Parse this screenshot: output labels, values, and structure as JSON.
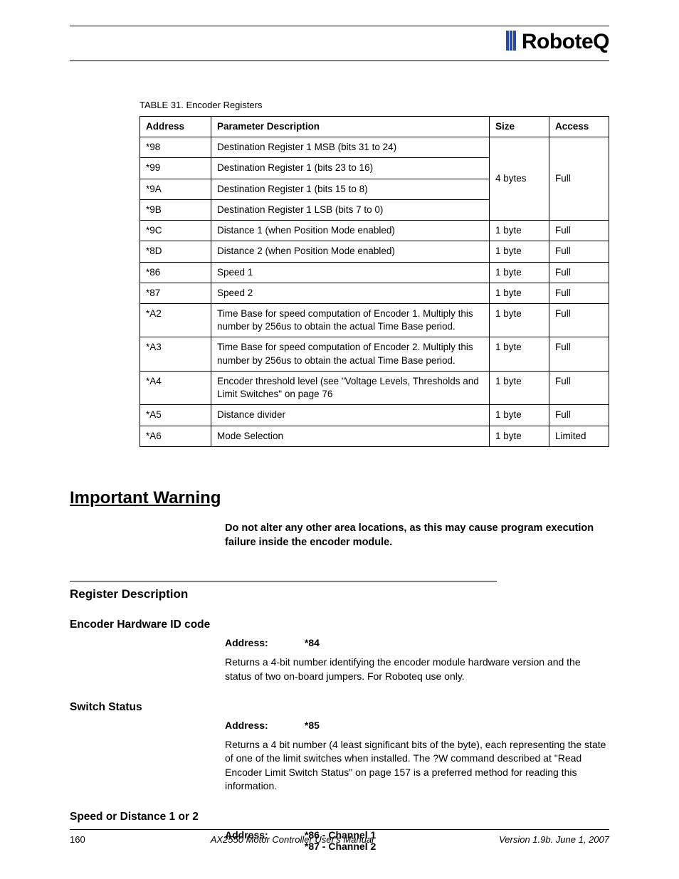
{
  "brand": "RoboteQ",
  "table": {
    "caption_label": "TABLE 31.",
    "caption_title": "Encoder Registers",
    "headers": {
      "address": "Address",
      "desc": "Parameter Description",
      "size": "Size",
      "access": "Access"
    },
    "group1": {
      "size": "4 bytes",
      "access": "Full",
      "rows": [
        {
          "addr": "*98",
          "desc": "Destination Register 1 MSB (bits 31 to 24)"
        },
        {
          "addr": "*99",
          "desc": "Destination Register 1 (bits 23 to 16)"
        },
        {
          "addr": "*9A",
          "desc": "Destination Register 1 (bits 15 to 8)"
        },
        {
          "addr": "*9B",
          "desc": "Destination Register 1 LSB (bits 7 to 0)"
        }
      ]
    },
    "rows": [
      {
        "addr": "*9C",
        "desc": "Distance 1 (when Position Mode enabled)",
        "size": "1 byte",
        "access": "Full"
      },
      {
        "addr": "*8D",
        "desc": "Distance 2 (when Position Mode enabled)",
        "size": "1 byte",
        "access": "Full"
      },
      {
        "addr": "*86",
        "desc": "Speed 1",
        "size": "1 byte",
        "access": "Full"
      },
      {
        "addr": "*87",
        "desc": "Speed 2",
        "size": "1 byte",
        "access": "Full"
      },
      {
        "addr": "*A2",
        "desc": "Time Base for speed computation of Encoder 1. Multiply this number by 256us to obtain the actual Time Base period.",
        "size": "1 byte",
        "access": "Full"
      },
      {
        "addr": "*A3",
        "desc": "Time Base for speed computation of Encoder 2. Multiply this number by 256us to obtain the actual Time Base period.",
        "size": "1 byte",
        "access": "Full"
      },
      {
        "addr": "*A4",
        "desc": "Encoder threshold level (see \"Voltage Levels, Thresholds and Limit Switches\" on page 76",
        "size": "1 byte",
        "access": "Full"
      },
      {
        "addr": "*A5",
        "desc": "Distance divider",
        "size": "1 byte",
        "access": "Full"
      },
      {
        "addr": "*A6",
        "desc": "Mode Selection",
        "size": "1 byte",
        "access": "Limited"
      }
    ]
  },
  "warning": {
    "heading": "Important Warning",
    "body": "Do not alter any other area locations, as this may cause program execution failure inside the encoder module."
  },
  "section_heading": "Register Description",
  "registers": [
    {
      "title": "Encoder Hardware ID code",
      "addr_label": "Address:",
      "addr_value": "*84",
      "body": "Returns a 4-bit number identifying the encoder module hardware version and the status of two on-board jumpers. For Roboteq use only."
    },
    {
      "title": "Switch Status",
      "addr_label": "Address:",
      "addr_value": "*85",
      "body": "Returns a 4 bit number (4 least significant bits of the byte), each representing the state of one of the limit switches when installed. The ?W command described at \"Read Encoder Limit Switch Status\" on page 157 is a preferred method for reading this information."
    },
    {
      "title": "Speed or Distance 1 or 2",
      "addr_label": "Address:",
      "addr_value": "*86 - Channel 1",
      "addr_value_2": "*87 - Channel 2",
      "body": ""
    }
  ],
  "footer": {
    "page": "160",
    "manual": "AX2550 Motor Controller User's Manual",
    "version": "Version 1.9b. June 1, 2007"
  }
}
